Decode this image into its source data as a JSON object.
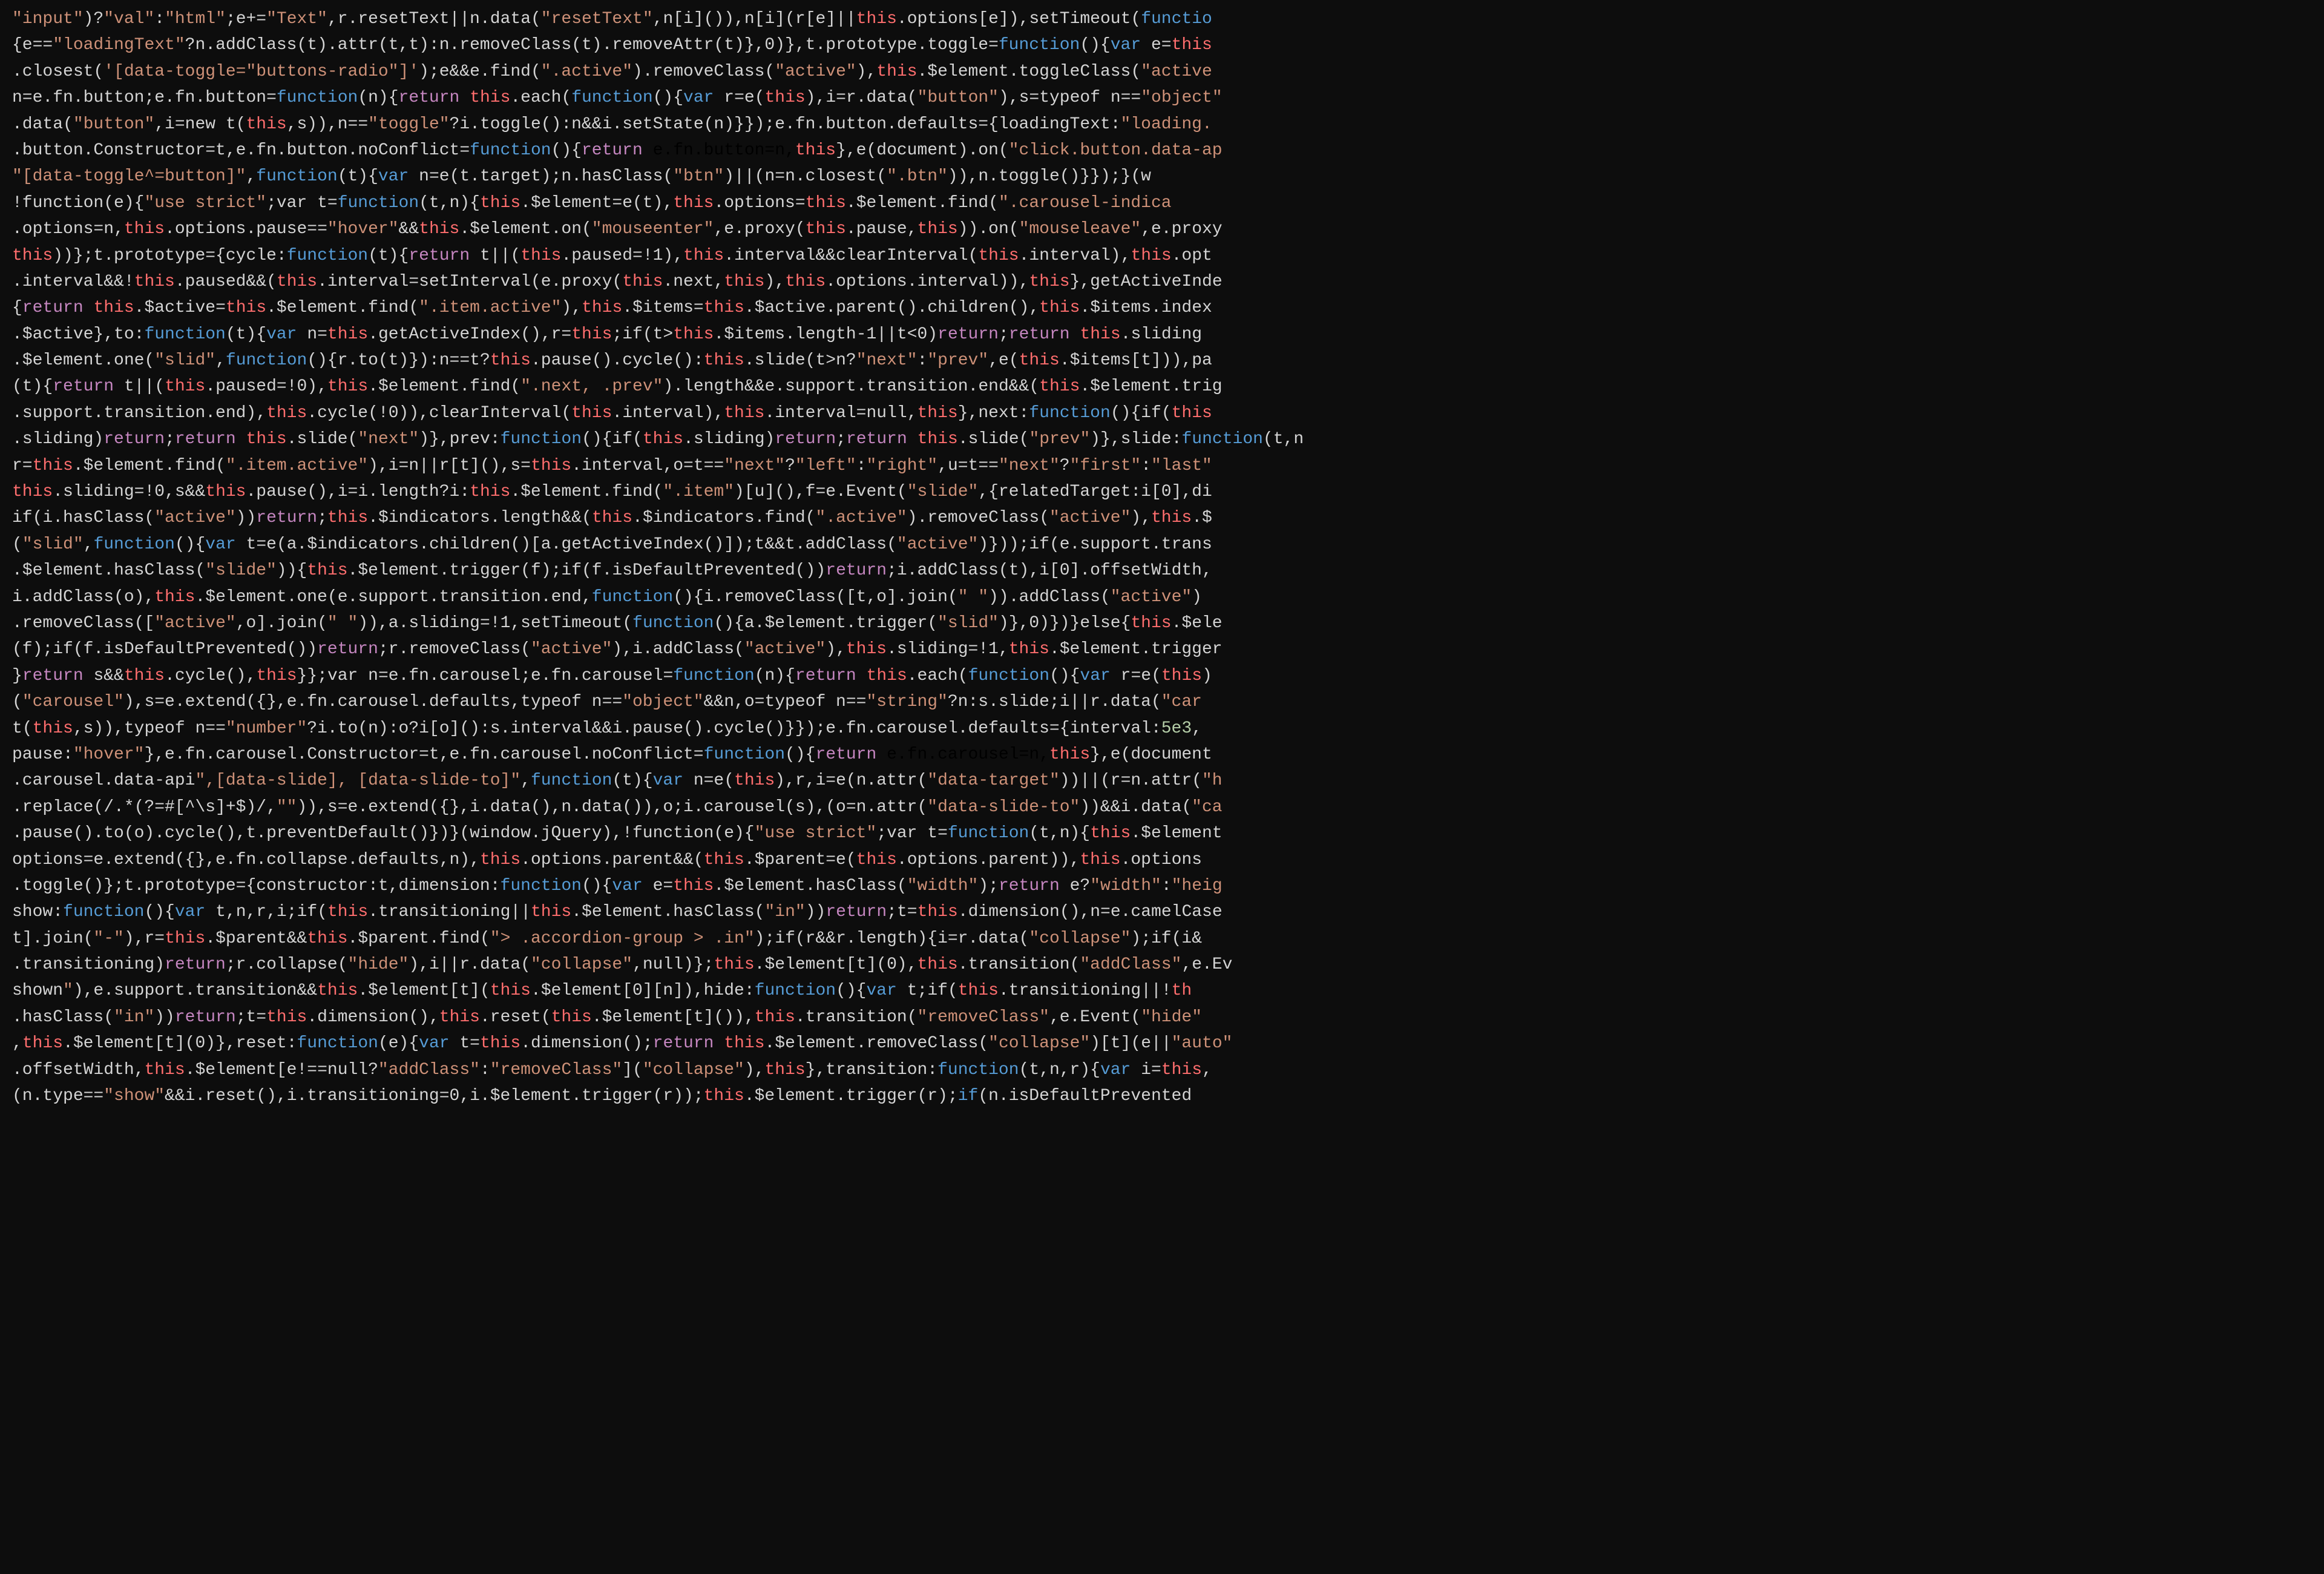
{
  "colors": {
    "background": "#0d0d0d",
    "string": "#ce9178",
    "keyword": "#569cd6",
    "function": "#dcdcaa",
    "property": "#9cdcfe",
    "number": "#b5cea8",
    "punctuation": "#d4d4d4",
    "this_keyword": "#ff6e6e",
    "return_keyword": "#c586c0",
    "plain": "#d4d4d4",
    "teal": "#4ec9b0"
  },
  "lines": [
    "<span class='str'>\"input\"</span><span class='plain'>)?</span><span class='str'>\"val\"</span><span class='plain'>:</span><span class='str'>\"html\"</span><span class='plain'>;e+=</span><span class='str'>\"Text\"</span><span class='plain'>,r.resetText||n.data(</span><span class='str'>\"resetText\"</span><span class='plain'>,n[i]()),n[i](r[e]||</span><span class='this_kw'>this</span><span class='plain'>.options[e]),setTimeout(</span><span class='kw'>functio</span>",
    "<span class='plain'>{e==</span><span class='str'>\"loadingText\"</span><span class='plain'>?n.addClass(t).attr(t,t):n.removeClass(t).removeAttr(t)},0)},t.prototype.toggle=</span><span class='kw'>function</span><span class='plain'>(){</span><span class='kw'>var</span> <span class='plain'>e=</span><span class='this_kw'>this</span>",
    "<span class='plain'>.closest(</span><span class='str'>'[data-toggle=\"buttons-radio\"]'</span><span class='plain'>);e&&e.find(</span><span class='str'>\".active\"</span><span class='plain'>).removeClass(</span><span class='str'>\"active\"</span><span class='plain'>),</span><span class='this_kw'>this</span><span class='plain'>.$element.toggleClass(</span><span class='str'>\"active</span>",
    "<span class='plain'>n=e.fn.button;e.fn.button=</span><span class='kw'>function</span><span class='plain'>(n){</span><span class='ret'>return</span> <span class='this_kw'>this</span><span class='plain'>.each(</span><span class='kw'>function</span><span class='plain'>(){</span><span class='kw'>var</span> <span class='plain'>r=e(</span><span class='this_kw'>this</span><span class='plain'>),i=r.data(</span><span class='str'>\"button\"</span><span class='plain'>),s=typeof n==</span><span class='str'>\"object\"</span>",
    "<span class='plain'>.data(</span><span class='str'>\"button\"</span><span class='plain'>,i=new t(</span><span class='this_kw'>this</span><span class='plain'>,s)),n==</span><span class='str'>\"toggle\"</span><span class='plain'>?i.toggle():n&&i.setState(n)}});e.fn.button.defaults={loadingText:</span><span class='str'>\"loading.</span>",
    "<span class='plain'>.button.Constructor=t,e.fn.button.noConflict=</span><span class='kw'>function</span><span class='plain'>(){</span><span class='ret'>return</span> e.fn.button=n,</span><span class='this_kw'>this</span><span class='plain'>},e(document).on(</span><span class='str'>\"click.button.data-ap</span>",
    "<span class='str'>\"[data-toggle^=button]\"</span><span class='plain'>,</span><span class='kw'>function</span><span class='plain'>(t){</span><span class='kw'>var</span> <span class='plain'>n=e(t.target);n.hasClass(</span><span class='str'>\"btn\"</span><span class='plain'>)||(n=n.closest(</span><span class='str'>\".btn\"</span><span class='plain'>)),n.toggle()}});}(w</span>",
    "<span class='plain'>!function(e){</span><span class='str'>\"use strict\"</span><span class='plain'>;var t=</span><span class='kw'>function</span><span class='plain'>(t,n){</span><span class='this_kw'>this</span><span class='plain'>.$element=e(t),</span><span class='this_kw'>this</span><span class='plain'>.options=</span><span class='this_kw'>this</span><span class='plain'>.$element.find(</span><span class='str'>\".carousel-indica</span>",
    "<span class='plain'>.options=n,</span><span class='this_kw'>this</span><span class='plain'>.options.pause==</span><span class='str'>\"hover\"</span><span class='plain'>&&</span><span class='this_kw'>this</span><span class='plain'>.$element.on(</span><span class='str'>\"mouseenter\"</span><span class='plain'>,e.proxy(</span><span class='this_kw'>this</span><span class='plain'>.pause,</span><span class='this_kw'>this</span><span class='plain'>)).on(</span><span class='str'>\"mouseleave\"</span><span class='plain'>,e.proxy</span>",
    "<span class='this_kw'>this</span><span class='plain'>))};t.prototype={cycle:</span><span class='kw'>function</span><span class='plain'>(t){</span><span class='ret'>return</span> <span class='plain'>t||(</span><span class='this_kw'>this</span><span class='plain'>.paused=!1),</span><span class='this_kw'>this</span><span class='plain'>.interval&&clearInterval(</span><span class='this_kw'>this</span><span class='plain'>.interval),</span><span class='this_kw'>this</span><span class='plain'>.opt</span>",
    "<span class='plain'>.interval&&!</span><span class='this_kw'>this</span><span class='plain'>.paused&&(</span><span class='this_kw'>this</span><span class='plain'>.interval=setInterval(e.proxy(</span><span class='this_kw'>this</span><span class='plain'>.next,</span><span class='this_kw'>this</span><span class='plain'>),</span><span class='this_kw'>this</span><span class='plain'>.options.interval)),</span><span class='this_kw'>this</span><span class='plain'>},getActiveInde</span>",
    "<span class='plain'>{</span><span class='ret'>return</span> <span class='this_kw'>this</span><span class='plain'>.$active=</span><span class='this_kw'>this</span><span class='plain'>.$element.find(</span><span class='str'>\".item.active\"</span><span class='plain'>),</span><span class='this_kw'>this</span><span class='plain'>.$items=</span><span class='this_kw'>this</span><span class='plain'>.$active.parent().children(),</span><span class='this_kw'>this</span><span class='plain'>.$items.index</span>",
    "<span class='plain'>.$active},to:</span><span class='kw'>function</span><span class='plain'>(t){</span><span class='kw'>var</span> <span class='plain'>n=</span><span class='this_kw'>this</span><span class='plain'>.getActiveIndex(),r=</span><span class='this_kw'>this</span><span class='plain'>;if(t></span><span class='this_kw'>this</span><span class='plain'>.$items.length-1||t&lt;0)</span><span class='ret'>return</span><span class='plain'>;</span><span class='ret'>return</span> <span class='this_kw'>this</span><span class='plain'>.sliding</span>",
    "<span class='plain'>.$element.one(</span><span class='str'>\"slid\"</span><span class='plain'>,</span><span class='kw'>function</span><span class='plain'>(){r.to(t)}):n==t?</span><span class='this_kw'>this</span><span class='plain'>.pause().cycle():</span><span class='this_kw'>this</span><span class='plain'>.slide(t&gt;n?</span><span class='str'>\"next\"</span><span class='plain'>:</span><span class='str'>\"prev\"</span><span class='plain'>,e(</span><span class='this_kw'>this</span><span class='plain'>.$items[t])),pa</span>",
    "<span class='plain'>(t){</span><span class='ret'>return</span> <span class='plain'>t||(</span><span class='this_kw'>this</span><span class='plain'>.paused=!0),</span><span class='this_kw'>this</span><span class='plain'>.$element.find(</span><span class='str'>\".next, .prev\"</span><span class='plain'>).length&&e.support.transition.end&&(</span><span class='this_kw'>this</span><span class='plain'>.$element.trig</span>",
    "<span class='plain'>.support.transition.end),</span><span class='this_kw'>this</span><span class='plain'>.cycle(!0)),clearInterval(</span><span class='this_kw'>this</span><span class='plain'>.interval),</span><span class='this_kw'>this</span><span class='plain'>.interval=null,</span><span class='this_kw'>this</span><span class='plain'>},next:</span><span class='kw'>function</span><span class='plain'>(){if(</span><span class='this_kw'>this</span>",
    "<span class='plain'>.sliding)</span><span class='ret'>return</span><span class='plain'>;</span><span class='ret'>return</span> <span class='this_kw'>this</span><span class='plain'>.slide(</span><span class='str'>\"next\"</span><span class='plain'>)},prev:</span><span class='kw'>function</span><span class='plain'>(){if(</span><span class='this_kw'>this</span><span class='plain'>.sliding)</span><span class='ret'>return</span><span class='plain'>;</span><span class='ret'>return</span> <span class='this_kw'>this</span><span class='plain'>.slide(</span><span class='str'>\"prev\"</span><span class='plain'>)},slide:</span><span class='kw'>function</span><span class='plain'>(t,n</span>",
    "<span class='plain'>r=</span><span class='this_kw'>this</span><span class='plain'>.$element.find(</span><span class='str'>\".item.active\"</span><span class='plain'>),i=n||r[t](),s=</span><span class='this_kw'>this</span><span class='plain'>.interval,o=t==</span><span class='str'>\"next\"</span><span class='plain'>?</span><span class='str'>\"left\"</span><span class='plain'>:</span><span class='str'>\"right\"</span><span class='plain'>,u=t==</span><span class='str'>\"next\"</span><span class='plain'>?</span><span class='str'>\"first\"</span><span class='plain'>:</span><span class='str'>\"last\"</span>",
    "<span class='this_kw'>this</span><span class='plain'>.sliding=!0,s&&</span><span class='this_kw'>this</span><span class='plain'>.pause(),i=i.length?i:</span><span class='this_kw'>this</span><span class='plain'>.$element.find(</span><span class='str'>\".item\"</span><span class='plain'>)[u](),f=e.Event(</span><span class='str'>\"slide\"</span><span class='plain'>,{relatedTarget:i[0],di</span>",
    "<span class='plain'>if(i.hasClass(</span><span class='str'>\"active\"</span><span class='plain'>))</span><span class='ret'>return</span><span class='plain'>;</span><span class='this_kw'>this</span><span class='plain'>.$indicators.length&&(</span><span class='this_kw'>this</span><span class='plain'>.$indicators.find(</span><span class='str'>\".active\"</span><span class='plain'>).removeClass(</span><span class='str'>\"active\"</span><span class='plain'>),</span><span class='this_kw'>this</span><span class='plain'>.$</span>",
    "<span class='plain'>(</span><span class='str'>\"slid\"</span><span class='plain'>,</span><span class='kw'>function</span><span class='plain'>(){</span><span class='kw'>var</span> <span class='plain'>t=e(a.$indicators.children()[a.getActiveIndex()]);t&&t.addClass(</span><span class='str'>\"active\"</span><span class='plain'>)}));if(e.support.trans</span>",
    "<span class='plain'>.$element.hasClass(</span><span class='str'>\"slide\"</span><span class='plain'>)){</span><span class='this_kw'>this</span><span class='plain'>.$element.trigger(f);if(f.isDefaultPrevented())</span><span class='ret'>return</span><span class='plain'>;i.addClass(t),i[0].offsetWidth,</span>",
    "<span class='plain'>i.addClass(o),</span><span class='this_kw'>this</span><span class='plain'>.$element.one(e.support.transition.end,</span><span class='kw'>function</span><span class='plain'>(){i.removeClass([t,o].join(</span><span class='str'>\" \"</span><span class='plain'>)).addClass(</span><span class='str'>\"active\"</span><span class='plain'>)</span>",
    "<span class='plain'>.removeClass([</span><span class='str'>\"active\"</span><span class='plain'>,o].join(</span><span class='str'>\" \"</span><span class='plain'>)),a.sliding=!1,setTimeout(</span><span class='kw'>function</span><span class='plain'>(){a.$element.trigger(</span><span class='str'>\"slid\"</span><span class='plain'>)},0)})}else{</span><span class='this_kw'>this</span><span class='plain'>.$ele</span>",
    "<span class='plain'>(f);</span><span class='plain'>if(f.isDefaultPrevented())</span><span class='ret'>return</span><span class='plain'>;r.removeClass(</span><span class='str'>\"active\"</span><span class='plain'>),i.addClass(</span><span class='str'>\"active\"</span><span class='plain'>),</span><span class='this_kw'>this</span><span class='plain'>.sliding=!1,</span><span class='this_kw'>this</span><span class='plain'>.$element.trigger</span>",
    "<span class='plain'>}</span><span class='ret'>return</span> <span class='plain'>s&&</span><span class='this_kw'>this</span><span class='plain'>.cycle(),</span><span class='this_kw'>this</span><span class='plain'>}};var n=e.fn.carousel;e.fn.carousel=</span><span class='kw'>function</span><span class='plain'>(n){</span><span class='ret'>return</span> <span class='this_kw'>this</span><span class='plain'>.each(</span><span class='kw'>function</span><span class='plain'>(){</span><span class='kw'>var</span> <span class='plain'>r=e(</span><span class='this_kw'>this</span><span class='plain'>)</span>",
    "<span class='plain'>(</span><span class='str'>\"carousel\"</span><span class='plain'>),s=e.extend({},e.fn.carousel.defaults,typeof n==</span><span class='str'>\"object\"</span><span class='plain'>&&n,o=typeof n==</span><span class='str'>\"string\"</span><span class='plain'>?n:s.slide;i||r.data(</span><span class='str'>\"car</span>",
    "<span class='plain'>t(</span><span class='this_kw'>this</span><span class='plain'>,s)),typeof n==</span><span class='str'>\"number\"</span><span class='plain'>?i.to(n):o?i[o]():s.interval&&i.pause().cycle()}});e.fn.carousel.defaults={interval:</span><span class='num'>5e3</span><span class='plain'>,</span>",
    "<span class='plain'>pause:</span><span class='str'>\"hover\"</span><span class='plain'>},e.fn.carousel.Constructor=t,e.fn.carousel.noConflict=</span><span class='kw'>function</span><span class='plain'>(){</span><span class='ret'>return</span> e.fn.carousel=n,</span><span class='this_kw'>this</span><span class='plain'>},e(document</span>",
    "<span class='plain'>.carousel.data-api</span><span class='str'>\",[data-slide], [data-slide-to]\"</span><span class='plain'>,</span><span class='kw'>function</span><span class='plain'>(t){</span><span class='kw'>var</span> <span class='plain'>n=e(</span><span class='this_kw'>this</span><span class='plain'>),r,i=e(n.attr(</span><span class='str'>\"data-target\"</span><span class='plain'>))||(r=n.attr(</span><span class='str'>\"h</span>",
    "<span class='plain'>.replace(/.*(?=#[^\\s]+$)/,</span><span class='str'>\"\"</span><span class='plain'>)),s=e.extend({},i.data(),n.data()),o;i.carousel(s),(o=n.attr(</span><span class='str'>\"data-slide-to\"</span><span class='plain'>))&&i.data(</span><span class='str'>\"ca</span>",
    "<span class='plain'>.pause().to(o).cycle(),t.preventDefault()})}(window.jQuery),!function(e){</span><span class='str'>\"use strict\"</span><span class='plain'>;var t=</span><span class='kw'>function</span><span class='plain'>(t,n){</span><span class='this_kw'>this</span><span class='plain'>.$element</span>",
    "<span class='plain'>options=e.extend({},e.fn.collapse.defaults,n),</span><span class='this_kw'>this</span><span class='plain'>.options.parent&&(</span><span class='this_kw'>this</span><span class='plain'>.$parent=e(</span><span class='this_kw'>this</span><span class='plain'>.options.parent)),</span><span class='this_kw'>this</span><span class='plain'>.options</span>",
    "<span class='plain'>.toggle()};t.prototype={constructor:t,dimension:</span><span class='kw'>function</span><span class='plain'>(){</span><span class='kw'>var</span> <span class='plain'>e=</span><span class='this_kw'>this</span><span class='plain'>.$element.hasClass(</span><span class='str'>\"width\"</span><span class='plain'>);</span><span class='ret'>return</span> <span class='plain'>e?</span><span class='str'>\"width\"</span><span class='plain'>:</span><span class='str'>\"heig</span>",
    "<span class='plain'>show:</span><span class='kw'>function</span><span class='plain'>(){</span><span class='kw'>var</span> <span class='plain'>t,n,r,i;if(</span><span class='this_kw'>this</span><span class='plain'>.transitioning||</span><span class='this_kw'>this</span><span class='plain'>.$element.hasClass(</span><span class='str'>\"in\"</span><span class='plain'>))</span><span class='ret'>return</span><span class='plain'>;t=</span><span class='this_kw'>this</span><span class='plain'>.dimension(),n=e.camelCase</span>",
    "<span class='plain'>t].join(</span><span class='str'>\"-\"</span><span class='plain'>),r=</span><span class='this_kw'>this</span><span class='plain'>.$parent&&</span><span class='this_kw'>this</span><span class='plain'>.$parent.find(</span><span class='str'>\"> .accordion-group > .in\"</span><span class='plain'>);if(r&&r.length){i=r.data(</span><span class='str'>\"collapse\"</span><span class='plain'>);if(i&</span>",
    "<span class='plain'>.transitioning)</span><span class='ret'>return</span><span class='plain'>;r.collapse(</span><span class='str'>\"hide\"</span><span class='plain'>),i||r.data(</span><span class='str'>\"collapse\"</span><span class='plain'>,null)};</span><span class='this_kw'>this</span><span class='plain'>.$element[t](0),</span><span class='this_kw'>this</span><span class='plain'>.transition(</span><span class='str'>\"addClass\"</span><span class='plain'>,e.Ev</span>",
    "<span class='plain'>shown</span><span class='str'>\"</span><span class='plain'>),e.support.transition&&</span><span class='this_kw'>this</span><span class='plain'>.$element[t](</span><span class='this_kw'>this</span><span class='plain'>.$element[0][n]),hide:</span><span class='kw'>function</span><span class='plain'>(){</span><span class='kw'>var</span> <span class='plain'>t;if(</span><span class='this_kw'>this</span><span class='plain'>.transitioning||!</span><span class='this_kw'>th</span>",
    "<span class='plain'>.hasClass(</span><span class='str'>\"in\"</span><span class='plain'>))</span><span class='ret'>return</span><span class='plain'>;t=</span><span class='this_kw'>this</span><span class='plain'>.dimension(),</span><span class='this_kw'>this</span><span class='plain'>.reset(</span><span class='this_kw'>this</span><span class='plain'>.$element[t]()),</span><span class='this_kw'>this</span><span class='plain'>.transition(</span><span class='str'>\"removeClass\"</span><span class='plain'>,e.Event(</span><span class='str'>\"hide\"</span>",
    "<span class='plain'>,</span><span class='this_kw'>this</span><span class='plain'>.$element[t](0)},reset:</span><span class='kw'>function</span><span class='plain'>(e){</span><span class='kw'>var</span> <span class='plain'>t=</span><span class='this_kw'>this</span><span class='plain'>.dimension();</span><span class='ret'>return</span> <span class='this_kw'>this</span><span class='plain'>.$element.removeClass(</span><span class='str'>\"collapse\"</span><span class='plain'>)[t](e||</span><span class='str'>\"auto\"</span>",
    "<span class='plain'>.offsetWidth,</span><span class='this_kw'>this</span><span class='plain'>.$element[e!==null?</span><span class='str'>\"addClass\"</span><span class='plain'>:</span><span class='str'>\"removeClass\"</span><span class='plain'>](</span><span class='str'>\"collapse\"</span><span class='plain'>),</span><span class='this_kw'>this</span><span class='plain'>},transition:</span><span class='kw'>function</span><span class='plain'>(t,n,r){</span><span class='kw'>var</span> <span class='plain'>i=</span><span class='this_kw'>this</span><span class='plain'>,</span>",
    "<span class='plain'>(n.type==</span><span class='str'>\"show\"</span><span class='plain'>&&i.reset(),i.transitioning=0,i.$element.trigger(r));</span><span class='this_kw'>this</span><span class='plain'>.$element.trigger(r);</span><span class='kw'>if</span><span class='plain'>(n.isDefaultPrevented</span>"
  ]
}
